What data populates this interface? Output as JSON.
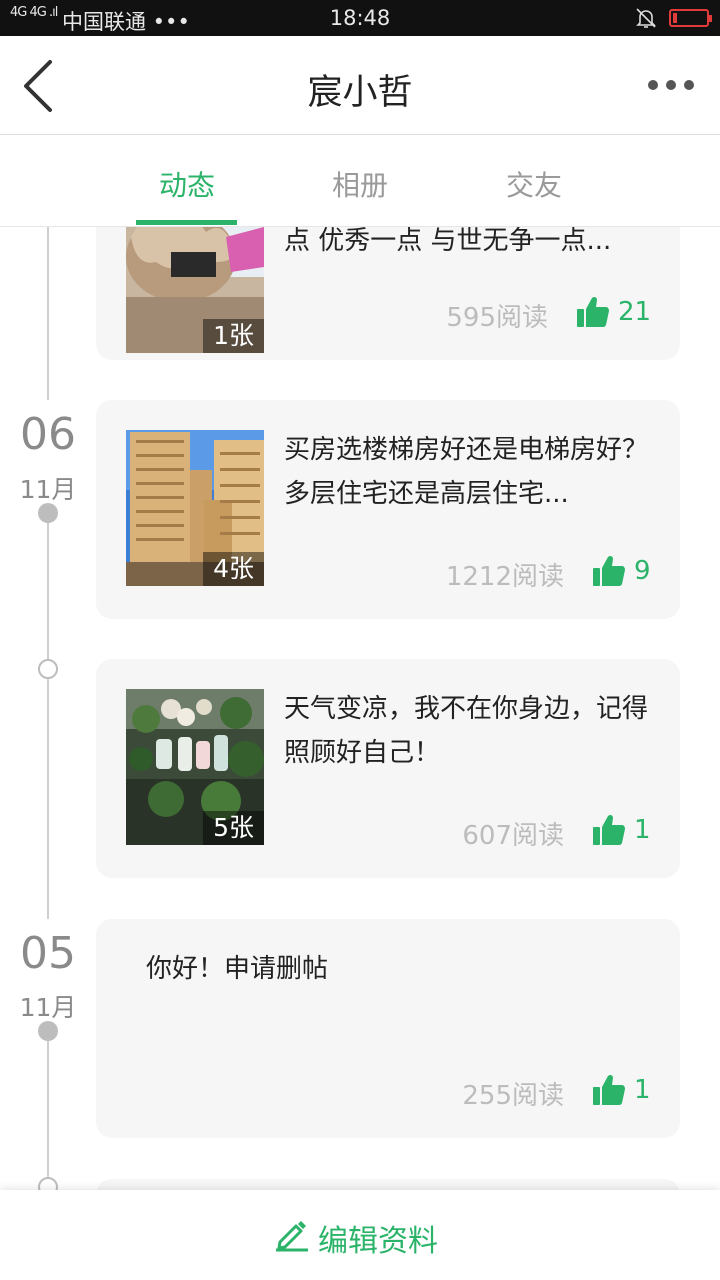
{
  "status_bar": {
    "signal": "4G 4G .ıl",
    "carrier": "中国联通 •••",
    "time": "18:48",
    "bell_icon": "bell-muted-icon",
    "battery_icon": "battery-low-icon",
    "battery_color": "#e03a3a"
  },
  "nav": {
    "title": "宸小哲",
    "back_icon": "chevron-left-icon",
    "more_icon": "more-dots-icon"
  },
  "tabs": [
    {
      "label": "动态",
      "active": true
    },
    {
      "label": "相册",
      "active": false
    },
    {
      "label": "交友",
      "active": false
    }
  ],
  "accent_color": "#2bb469",
  "timeline": {
    "date1": {
      "day": "06",
      "month": "11月"
    },
    "date2": {
      "day": "05",
      "month": "11月"
    }
  },
  "posts": [
    {
      "text": "点 优秀一点 与世无争一点...",
      "photo_count": "1张",
      "reads": "595阅读",
      "likes": "21"
    },
    {
      "text": "买房选楼梯房好还是电梯房好？多层住宅还是高层住宅...",
      "photo_count": "4张",
      "reads": "1212阅读",
      "likes": "9"
    },
    {
      "text": "天气变凉，我不在你身边，记得照顾好自己！",
      "photo_count": "5张",
      "reads": "607阅读",
      "likes": "1"
    },
    {
      "text": "你好！申请删帖",
      "reads": "255阅读",
      "likes": "1"
    }
  ],
  "bottom": {
    "label": "编辑资料",
    "icon": "edit-pencil-icon"
  }
}
